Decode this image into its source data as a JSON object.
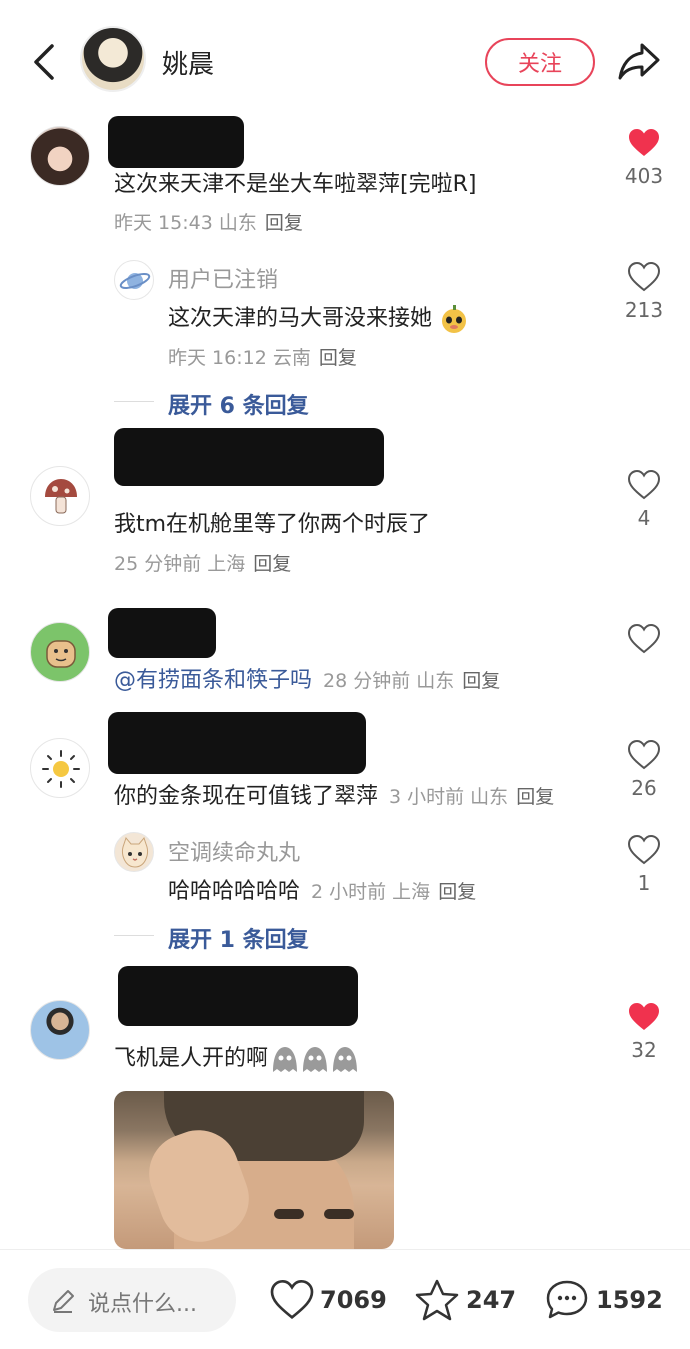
{
  "header": {
    "author_name": "姚晨",
    "follow_label": "关注"
  },
  "comments": [
    {
      "text": "这次来天津不是坐大车啦翠萍[完啦R]",
      "meta": "昨天 15:43 山东",
      "reply_label": "回复",
      "likes": "403",
      "liked": true,
      "replies": [
        {
          "name": "用户已注销",
          "text": "这次天津的马大哥没来接她",
          "meta": "昨天 16:12 云南",
          "reply_label": "回复",
          "likes": "213"
        }
      ],
      "expand_label": "展开 6 条回复"
    },
    {
      "text": "我tm在机舱里等了你两个时辰了",
      "meta": "25 分钟前 上海",
      "reply_label": "回复",
      "likes": "4",
      "avatar_icon": "mushroom-icon"
    },
    {
      "mention": "@有捞面条和筷子吗",
      "meta": "28 分钟前 山东",
      "reply_label": "回复"
    },
    {
      "text": "你的金条现在可值钱了翠萍",
      "meta": "3 小时前 山东",
      "reply_label": "回复",
      "likes": "26",
      "avatar_icon": "sun-icon",
      "replies": [
        {
          "name": "空调续命丸丸",
          "text": "哈哈哈哈哈哈",
          "meta": "2 小时前 上海",
          "reply_label": "回复",
          "likes": "1"
        }
      ],
      "expand_label": "展开 1 条回复"
    },
    {
      "text": "飞机是人开的啊",
      "likes": "32",
      "liked": true
    }
  ],
  "bottom_bar": {
    "input_placeholder": "说点什么...",
    "likes": "7069",
    "favorites": "247",
    "comments": "1592"
  },
  "colors": {
    "accent": "#e8445a",
    "link": "#3a5a99"
  }
}
